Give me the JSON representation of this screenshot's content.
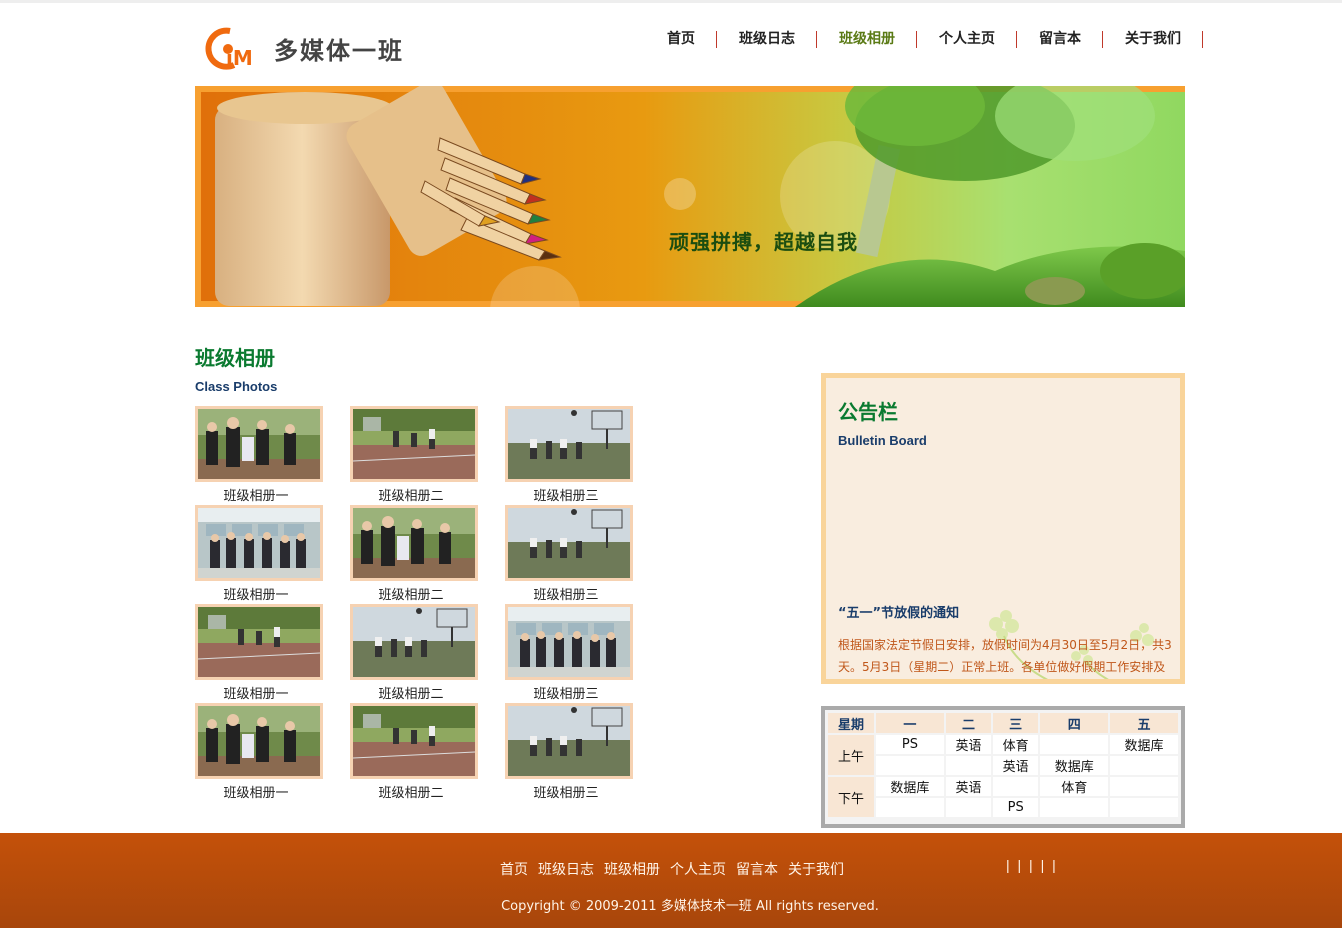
{
  "header": {
    "logo_text": "多媒体一班",
    "logo_mark_letters": "iM",
    "nav": [
      {
        "label": "首页",
        "active": false
      },
      {
        "label": "班级日志",
        "active": false
      },
      {
        "label": "班级相册",
        "active": true
      },
      {
        "label": "个人主页",
        "active": false
      },
      {
        "label": "留言本",
        "active": false
      },
      {
        "label": "关于我们",
        "active": false
      }
    ]
  },
  "banner": {
    "slogan": "顽强拼搏，超越自我"
  },
  "album": {
    "title": "班级相册",
    "subtitle": "Class Photos",
    "photos": [
      {
        "caption": "班级相册一",
        "scene": "students"
      },
      {
        "caption": "班级相册二",
        "scene": "court"
      },
      {
        "caption": "班级相册三",
        "scene": "basketball"
      },
      {
        "caption": "班级相册一",
        "scene": "classroom"
      },
      {
        "caption": "班级相册二",
        "scene": "students"
      },
      {
        "caption": "班级相册三",
        "scene": "basketball"
      },
      {
        "caption": "班级相册一",
        "scene": "court"
      },
      {
        "caption": "班级相册二",
        "scene": "basketball"
      },
      {
        "caption": "班级相册三",
        "scene": "classroom"
      },
      {
        "caption": "班级相册一",
        "scene": "students"
      },
      {
        "caption": "班级相册二",
        "scene": "court"
      },
      {
        "caption": "班级相册三",
        "scene": "basketball"
      }
    ]
  },
  "bulletin": {
    "title": "公告栏",
    "subtitle": "Bulletin Board",
    "notice_title": "“五一”节放假的通知",
    "notice_body": "根据国家法定节假日安排，放假时间为4月30日至5月2日，共3天。5月3日（星期二）正常上班。各单位做好假期工作安排及"
  },
  "timetable": {
    "headers": [
      "星期",
      "一",
      "二",
      "三",
      "四",
      "五"
    ],
    "periods": [
      {
        "label": "上午",
        "rows": [
          [
            "PS",
            "英语",
            "体育",
            "",
            "数据库"
          ],
          [
            "",
            "",
            "英语",
            "数据库",
            ""
          ]
        ]
      },
      {
        "label": "下午",
        "rows": [
          [
            "数据库",
            "英语",
            "",
            "体育",
            ""
          ],
          [
            "",
            "",
            "PS",
            "",
            ""
          ]
        ]
      }
    ]
  },
  "footer": {
    "links": [
      "首页",
      "班级日志",
      "班级相册",
      "个人主页",
      "留言本",
      "关于我们"
    ],
    "separators": "| | | | |",
    "copyright": "Copyright © 2009-2011 多媒体技术一班 All rights reserved."
  },
  "colors": {
    "accent_green": "#0a7a30",
    "nav_active": "#5a7a15",
    "footer_bg": "#c4510a",
    "board_border": "#f9d49a",
    "notice_text": "#c0571a"
  }
}
